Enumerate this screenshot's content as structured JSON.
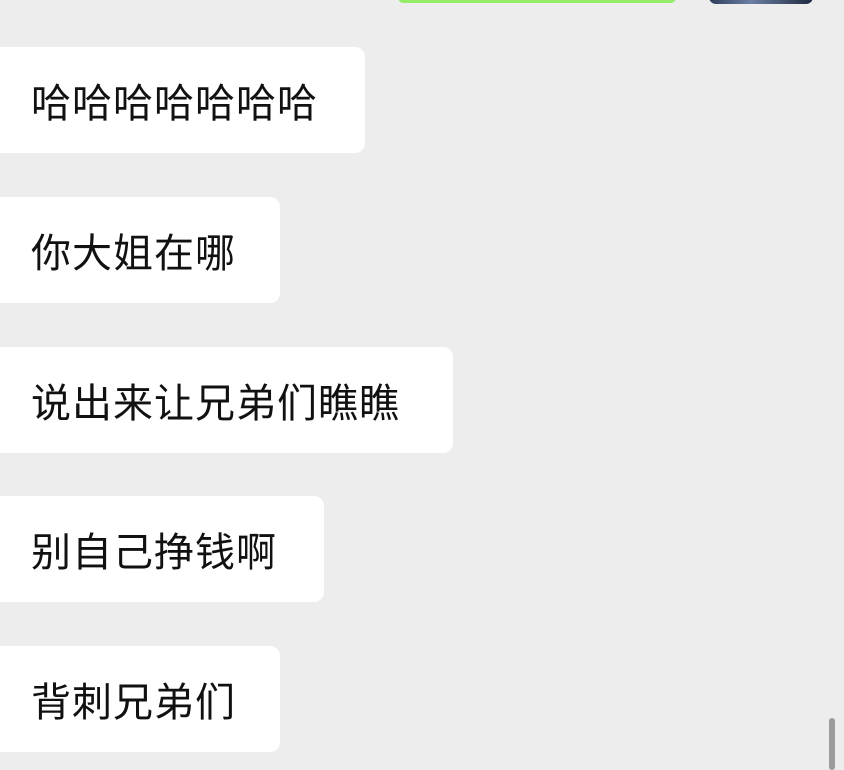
{
  "colors": {
    "background": "#ededed",
    "incoming_bubble": "#ffffff",
    "outgoing_bubble": "#95ec69",
    "text": "#111111"
  },
  "messages": [
    {
      "direction": "incoming",
      "text": "哈哈哈哈哈哈哈"
    },
    {
      "direction": "incoming",
      "text": "你大姐在哪"
    },
    {
      "direction": "incoming",
      "text": "说出来让兄弟们瞧瞧"
    },
    {
      "direction": "incoming",
      "text": "别自己挣钱啊"
    },
    {
      "direction": "incoming",
      "text": "背刺兄弟们"
    }
  ]
}
